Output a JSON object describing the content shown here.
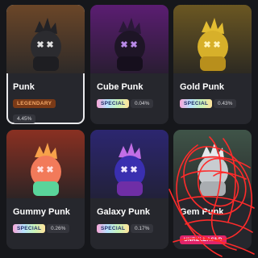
{
  "cards": [
    {
      "name": "Punk",
      "badge": "LEGENDARY",
      "badge_type": "legendary",
      "percent": "4.45%",
      "selected": true,
      "bg": "#5a3a25",
      "body_color": "#2b2b2f",
      "accent": "#d8d8d8"
    },
    {
      "name": "Cube Punk",
      "badge": "SPECIAL",
      "badge_type": "special",
      "percent": "0.04%",
      "selected": false,
      "bg": "#4a1a5e",
      "body_color": "#1e1526",
      "accent": "#a46bd8"
    },
    {
      "name": "Gold Punk",
      "badge": "SPECIAL",
      "badge_type": "special",
      "percent": "0.43%",
      "selected": false,
      "bg": "#5a4a20",
      "body_color": "#d7b02a",
      "accent": "#fff1a0"
    },
    {
      "name": "Gummy Punk",
      "badge": "SPECIAL",
      "badge_type": "special",
      "percent": "0.26%",
      "selected": false,
      "bg": "#6a2a22",
      "body_color": "#f27a5a",
      "accent": "#9cf2b0"
    },
    {
      "name": "Galaxy Punk",
      "badge": "SPECIAL",
      "badge_type": "special",
      "percent": "0.17%",
      "selected": false,
      "bg": "#2a2360",
      "body_color": "#3a2fb0",
      "accent": "#d76af0"
    },
    {
      "name": "Gem Punk",
      "badge": "UNRELEASED",
      "badge_type": "unreleased",
      "percent": "",
      "selected": false,
      "bg": "#3a4a40",
      "body_color": "#c8ccd0",
      "accent": "#ffffff"
    }
  ]
}
